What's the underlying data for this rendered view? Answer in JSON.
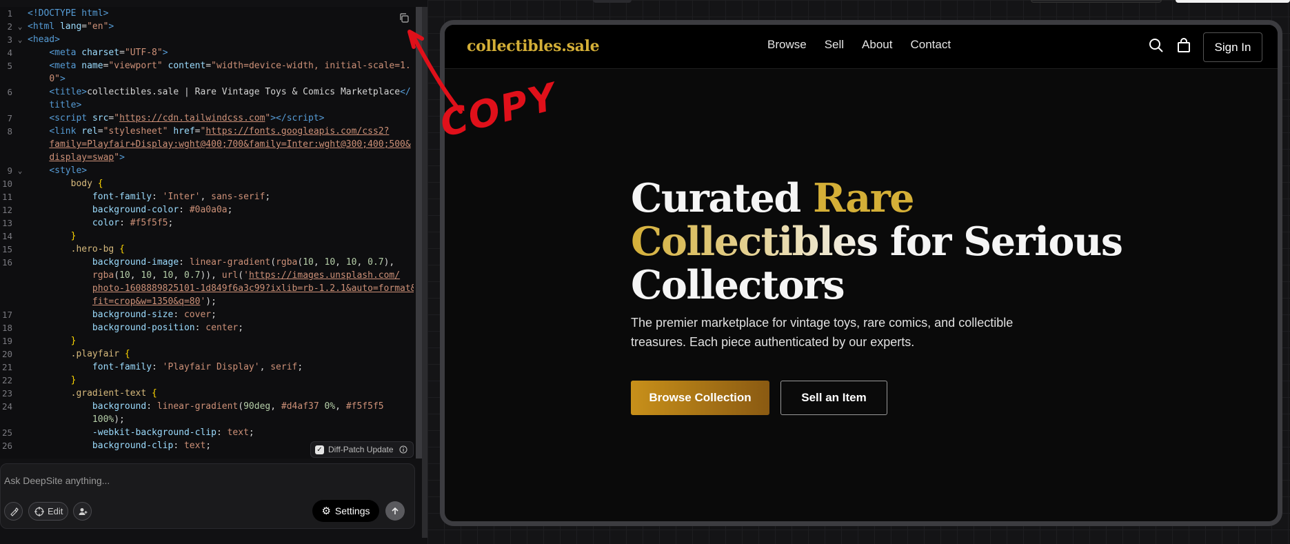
{
  "editor": {
    "lines": [
      {
        "n": "1",
        "fold": false,
        "html": "<span class='tag'>&lt;!DOCTYPE html&gt;</span>"
      },
      {
        "n": "2",
        "fold": true,
        "html": "<span class='tag'>&lt;html</span> <span class='attr'>lang</span>=<span class='str'>\"en\"</span><span class='tag'>&gt;</span>"
      },
      {
        "n": "3",
        "fold": true,
        "html": "<span class='tag'>&lt;head&gt;</span>"
      },
      {
        "n": "4",
        "fold": false,
        "html": "    <span class='tag'>&lt;meta</span> <span class='attr'>charset</span>=<span class='str'>\"UTF-8\"</span><span class='tag'>&gt;</span>"
      },
      {
        "n": "5",
        "fold": false,
        "html": "    <span class='tag'>&lt;meta</span> <span class='attr'>name</span>=<span class='str'>\"viewport\"</span> <span class='attr'>content</span>=<span class='str'>\"width=device-width, initial-scale=1.</span>"
      },
      {
        "n": "",
        "fold": false,
        "html": "    <span class='str'>0\"</span><span class='tag'>&gt;</span>"
      },
      {
        "n": "6",
        "fold": false,
        "html": "    <span class='tag'>&lt;title&gt;</span>collectibles.sale | Rare Vintage Toys &amp; Comics Marketplace<span class='tag'>&lt;/</span>"
      },
      {
        "n": "",
        "fold": false,
        "html": "    <span class='tag'>title&gt;</span>"
      },
      {
        "n": "7",
        "fold": false,
        "html": "    <span class='tag'>&lt;script</span> <span class='attr'>src</span>=<span class='str'>\"</span><span class='link'>https://cdn.tailwindcss.com</span><span class='str'>\"</span><span class='tag'>&gt;&lt;/script&gt;</span>"
      },
      {
        "n": "8",
        "fold": false,
        "html": "    <span class='tag'>&lt;link</span> <span class='attr'>rel</span>=<span class='str'>\"stylesheet\"</span> <span class='attr'>href</span>=<span class='str'>\"</span><span class='link'>https://fonts.googleapis.com/css2?</span>"
      },
      {
        "n": "",
        "fold": false,
        "html": "    <span class='link'>family=Playfair+Display:wght@400;700&amp;family=Inter:wght@300;400;500&amp;</span>"
      },
      {
        "n": "",
        "fold": false,
        "html": "    <span class='link'>display=swap</span><span class='str'>\"</span><span class='tag'>&gt;</span>"
      },
      {
        "n": "9",
        "fold": true,
        "html": "    <span class='tag'>&lt;style&gt;</span>"
      },
      {
        "n": "10",
        "fold": false,
        "html": "        <span class='sel'>body</span> <span class='brace'>{</span>"
      },
      {
        "n": "11",
        "fold": false,
        "html": "            <span class='prop'>font-family</span>: <span class='val'>'Inter'</span>, <span class='val'>sans-serif</span>;"
      },
      {
        "n": "12",
        "fold": false,
        "html": "            <span class='prop'>background-color</span>: <span class='val'>#0a0a0a</span>;"
      },
      {
        "n": "13",
        "fold": false,
        "html": "            <span class='prop'>color</span>: <span class='val'>#f5f5f5</span>;"
      },
      {
        "n": "14",
        "fold": false,
        "html": "        <span class='brace'>}</span>"
      },
      {
        "n": "15",
        "fold": false,
        "html": "        <span class='sel'>.hero-bg</span> <span class='brace'>{</span>"
      },
      {
        "n": "16",
        "fold": false,
        "html": "            <span class='prop'>background-image</span>: <span class='val'>linear-gradient</span>(<span class='val'>rgba</span>(<span class='num'>10</span>, <span class='num'>10</span>, <span class='num'>10</span>, <span class='num'>0.7</span>),"
      },
      {
        "n": "",
        "fold": false,
        "html": "            <span class='val'>rgba</span>(<span class='num'>10</span>, <span class='num'>10</span>, <span class='num'>10</span>, <span class='num'>0.7</span>)), <span class='val'>url</span>(<span class='str'>'</span><span class='link'>https://images.unsplash.com/</span>"
      },
      {
        "n": "",
        "fold": false,
        "html": "            <span class='link'>photo-1608889825101-1d849f6a3c99?ixlib=rb-1.2.1&amp;auto=format&amp;</span>"
      },
      {
        "n": "",
        "fold": false,
        "html": "            <span class='link'>fit=crop&amp;w=1350&amp;q=80</span><span class='str'>'</span>);"
      },
      {
        "n": "17",
        "fold": false,
        "html": "            <span class='prop'>background-size</span>: <span class='val'>cover</span>;"
      },
      {
        "n": "18",
        "fold": false,
        "html": "            <span class='prop'>background-position</span>: <span class='val'>center</span>;"
      },
      {
        "n": "19",
        "fold": false,
        "html": "        <span class='brace'>}</span>"
      },
      {
        "n": "20",
        "fold": false,
        "html": "        <span class='sel'>.playfair</span> <span class='brace'>{</span>"
      },
      {
        "n": "21",
        "fold": false,
        "html": "            <span class='prop'>font-family</span>: <span class='val'>'Playfair Display'</span>, <span class='val'>serif</span>;"
      },
      {
        "n": "22",
        "fold": false,
        "html": "        <span class='brace'>}</span>"
      },
      {
        "n": "23",
        "fold": false,
        "html": "        <span class='sel'>.gradient-text</span> <span class='brace'>{</span>"
      },
      {
        "n": "24",
        "fold": false,
        "html": "            <span class='prop'>background</span>: <span class='val'>linear-gradient</span>(<span class='num'>90deg</span>, <span class='val'>#d4af37</span> <span class='num'>0%</span>, <span class='val'>#f5f5f5</span>"
      },
      {
        "n": "",
        "fold": false,
        "html": "            <span class='num'>100%</span>);"
      },
      {
        "n": "25",
        "fold": false,
        "html": "            <span class='prop'>-webkit-background-clip</span>: <span class='val'>text</span>;"
      },
      {
        "n": "26",
        "fold": false,
        "html": "            <span class='prop'>background-clip</span>: <span class='val'>text</span>;"
      }
    ],
    "copy_icon": "copy-icon",
    "diff_patch_label": "Diff-Patch Update",
    "diff_patch_checked": true
  },
  "chat": {
    "placeholder": "Ask DeepSite anything...",
    "edit_label": "Edit",
    "settings_label": "Settings"
  },
  "site": {
    "logo": "collectibles.sale",
    "nav": [
      "Browse",
      "Sell",
      "About",
      "Contact"
    ],
    "signin_label": "Sign In",
    "hero": {
      "title_1": "Curated ",
      "title_rare": "Rare",
      "title_collectibles": "Collectibles",
      "title_2": " for Serious Collectors",
      "subtitle": "The premier marketplace for vintage toys, rare comics, and collectible treasures. Each piece authenticated by our experts.",
      "primary_cta": "Browse Collection",
      "secondary_cta": "Sell an Item"
    },
    "colors": {
      "accent": "#d4af37",
      "background": "#0a0a0a",
      "text": "#f5f5f5"
    }
  },
  "annotation": {
    "text": "COPY",
    "color": "#e0101a"
  }
}
